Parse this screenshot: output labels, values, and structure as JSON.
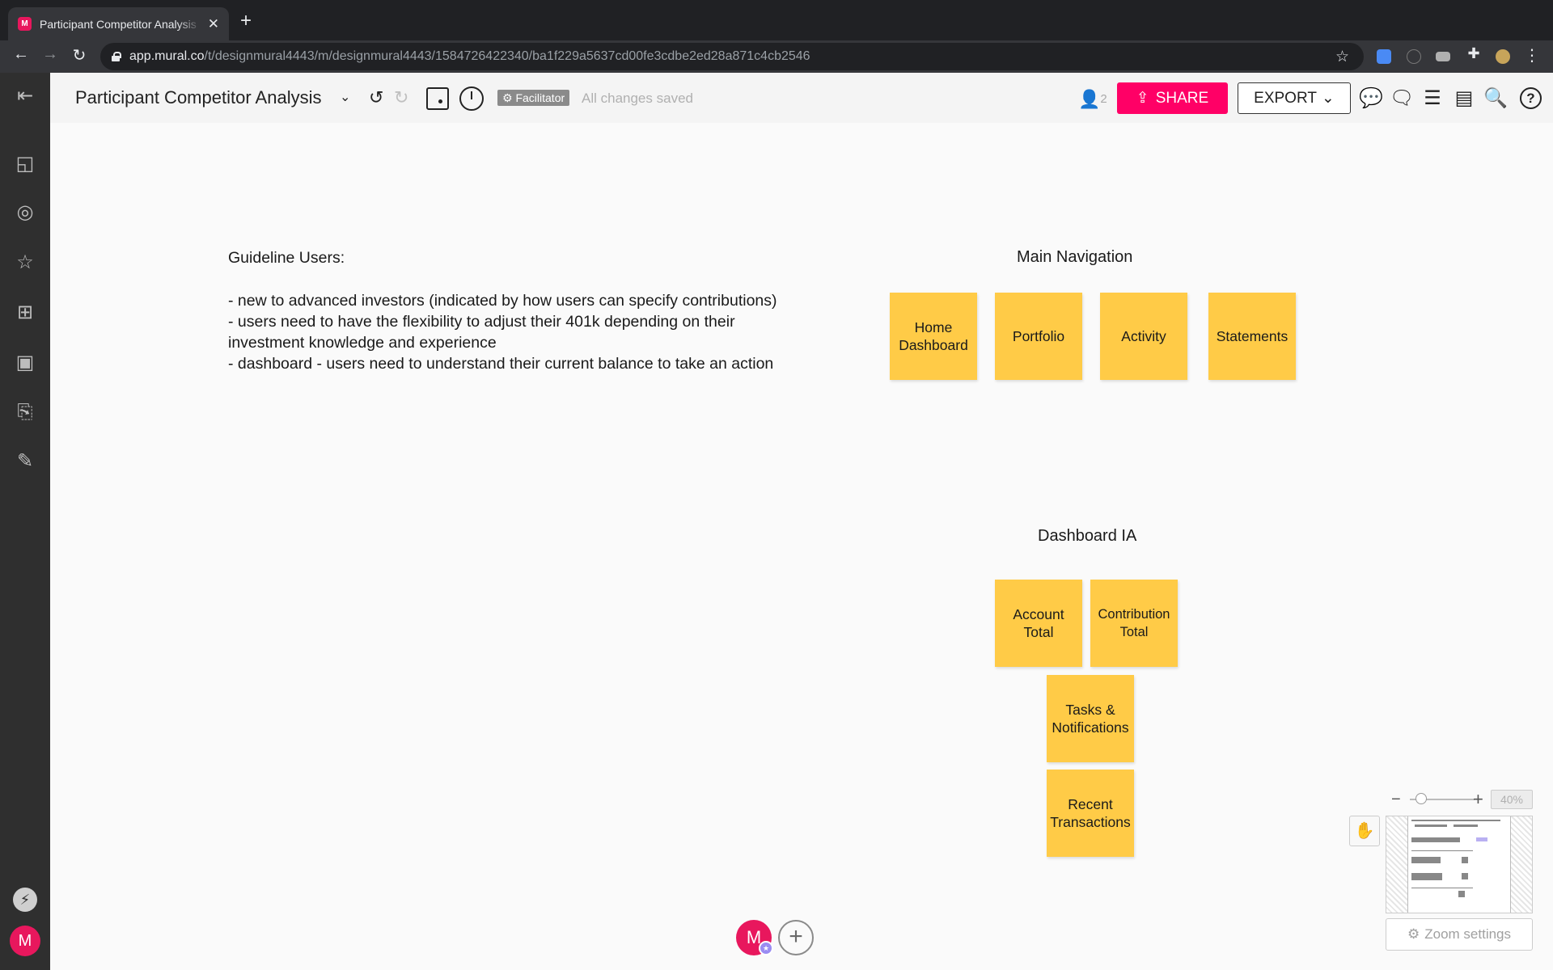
{
  "browser": {
    "tab_title": "Participant Competitor Analysis",
    "tab_favicon": "M",
    "url_host": "app.mural.co",
    "url_path": "/t/designmural4443/m/designmural4443/1584726422340/ba1f229a5637cd00fe3cdbe2ed28a871c4cb2546",
    "icons": [
      "back-icon",
      "forward-icon",
      "reload-icon",
      "lock-icon",
      "bookmark-star-icon",
      "zoom-extension-icon",
      "puzzle-extension-icon",
      "profile-avatar-icon",
      "menu-kebab-icon"
    ]
  },
  "toolbar": {
    "title": "Participant Competitor Analysis",
    "facilitator_label": "Facilitator",
    "saved_status": "All changes saved",
    "collaborator_count": "2",
    "share_label": "SHARE",
    "export_label": "EXPORT",
    "help_label": "?"
  },
  "canvas": {
    "guidelines": "Guideline Users:\n\n- new to advanced investors (indicated by how users can specify contributions)\n- users need to have the flexibility to adjust their 401k depending on their investment knowledge and experience\n- dashboard - users need to understand their current balance to take an action",
    "main_navigation": {
      "title": "Main Navigation",
      "stickies": [
        "Home Dashboard",
        "Portfolio",
        "Activity",
        "Statements"
      ]
    },
    "dashboard_ia": {
      "title": "Dashboard IA",
      "stickies": [
        "Account Total",
        "Contribution Total",
        "Tasks & Notifications",
        "Recent Transactions"
      ]
    },
    "sticky_color": "#ffcb47"
  },
  "footer": {
    "avatar_letter": "M",
    "invite_label": "+",
    "zoom_minus": "−",
    "zoom_plus": "+",
    "zoom_percent": "40%",
    "zoom_settings_label": "Zoom settings"
  },
  "rail": {
    "avatar_letter": "M"
  },
  "colors": {
    "brand": "#e8175d",
    "share": "#ff0066"
  }
}
